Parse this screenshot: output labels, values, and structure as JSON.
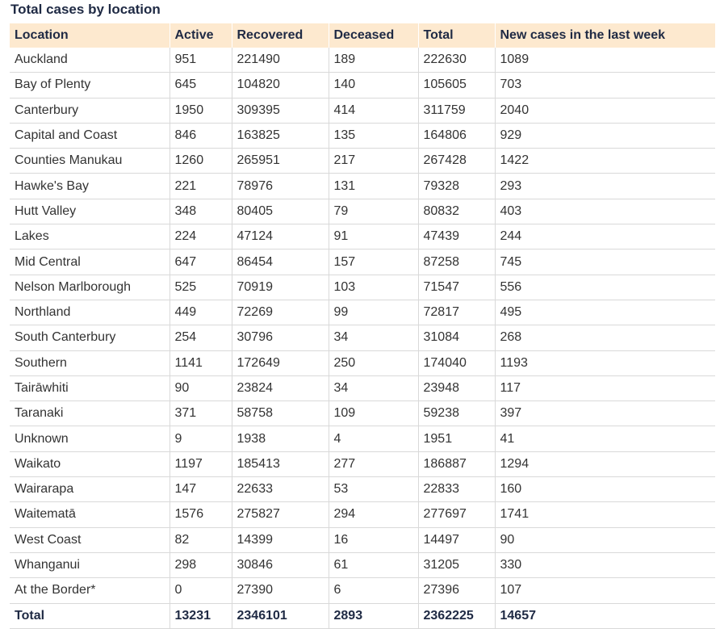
{
  "title": "Total cases by location",
  "columns": [
    "Location",
    "Active",
    "Recovered",
    "Deceased",
    "Total",
    "New cases in the last week"
  ],
  "rows": [
    [
      "Auckland",
      "951",
      "221490",
      "189",
      "222630",
      "1089"
    ],
    [
      "Bay of Plenty",
      "645",
      "104820",
      "140",
      "105605",
      "703"
    ],
    [
      "Canterbury",
      "1950",
      "309395",
      "414",
      "311759",
      "2040"
    ],
    [
      "Capital and Coast",
      "846",
      "163825",
      "135",
      "164806",
      "929"
    ],
    [
      "Counties Manukau",
      "1260",
      "265951",
      "217",
      "267428",
      "1422"
    ],
    [
      "Hawke's Bay",
      "221",
      "78976",
      "131",
      "79328",
      "293"
    ],
    [
      "Hutt Valley",
      "348",
      "80405",
      "79",
      "80832",
      "403"
    ],
    [
      "Lakes",
      "224",
      "47124",
      "91",
      "47439",
      "244"
    ],
    [
      "Mid Central",
      "647",
      "86454",
      "157",
      "87258",
      "745"
    ],
    [
      "Nelson Marlborough",
      "525",
      "70919",
      "103",
      "71547",
      "556"
    ],
    [
      "Northland",
      "449",
      "72269",
      "99",
      "72817",
      "495"
    ],
    [
      "South Canterbury",
      "254",
      "30796",
      "34",
      "31084",
      "268"
    ],
    [
      "Southern",
      "1141",
      "172649",
      "250",
      "174040",
      "1193"
    ],
    [
      "Tairāwhiti",
      "90",
      "23824",
      "34",
      "23948",
      "117"
    ],
    [
      "Taranaki",
      "371",
      "58758",
      "109",
      "59238",
      "397"
    ],
    [
      "Unknown",
      "9",
      "1938",
      "4",
      "1951",
      "41"
    ],
    [
      "Waikato",
      "1197",
      "185413",
      "277",
      "186887",
      "1294"
    ],
    [
      "Wairarapa",
      "147",
      "22633",
      "53",
      "22833",
      "160"
    ],
    [
      "Waitematā",
      "1576",
      "275827",
      "294",
      "277697",
      "1741"
    ],
    [
      "West Coast",
      "82",
      "14399",
      "16",
      "14497",
      "90"
    ],
    [
      "Whanganui",
      "298",
      "30846",
      "61",
      "31205",
      "330"
    ],
    [
      "At the Border*",
      "0",
      "27390",
      "6",
      "27396",
      "107"
    ]
  ],
  "total": [
    "Total",
    "13231",
    "2346101",
    "2893",
    "2362225",
    "14657"
  ]
}
